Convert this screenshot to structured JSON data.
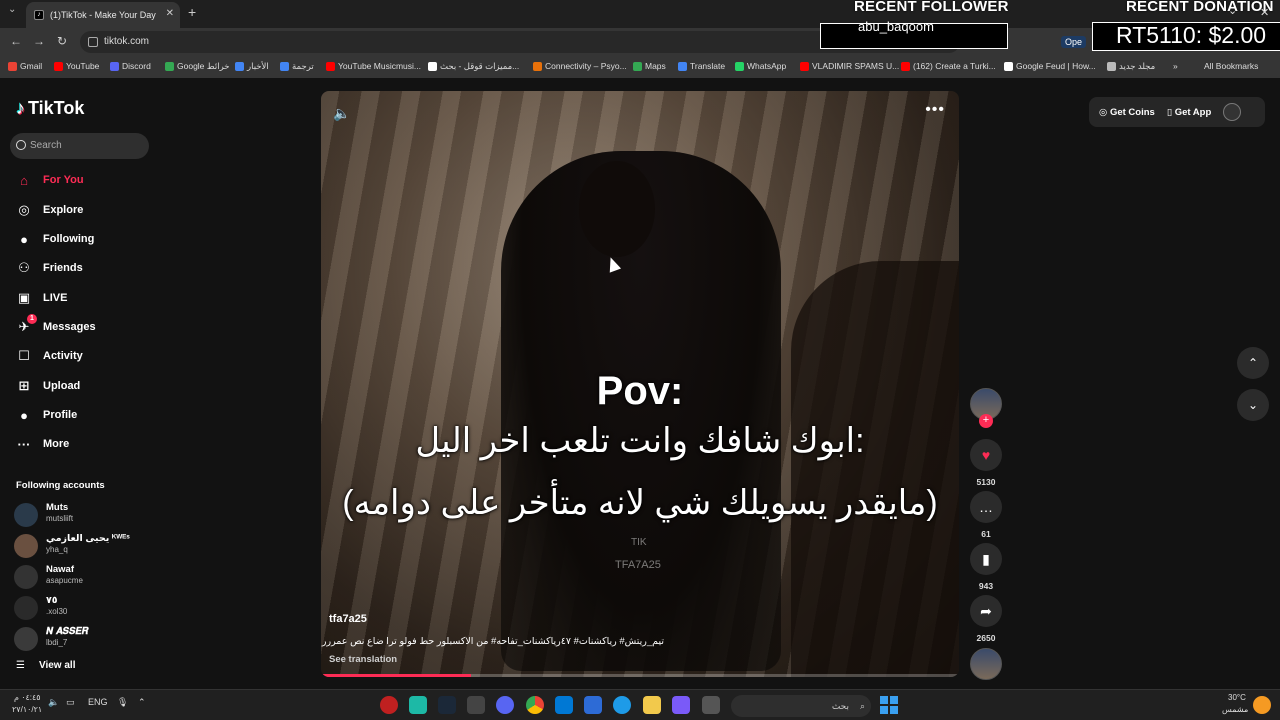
{
  "browser": {
    "tab_title": "(1)TikTok - Make Your Day",
    "tab_favicon": "tiktok-favicon",
    "new_tab": "+",
    "tab_close": "✕",
    "url": "tiktok.com",
    "bookmarks": [
      {
        "label": "Gmail",
        "color": "#ea4335"
      },
      {
        "label": "YouTube",
        "color": "#ff0000"
      },
      {
        "label": "Discord",
        "color": "#5865f2"
      },
      {
        "label": "Google خرائط",
        "color": "#34a853"
      },
      {
        "label": "الأخبار",
        "color": "#4285f4"
      },
      {
        "label": "ترجمة",
        "color": "#4285f4"
      },
      {
        "label": "YouTube Musicmusi...",
        "color": "#ff0000"
      },
      {
        "label": "مميزات قوقل - بحث...",
        "color": "#ffffff"
      },
      {
        "label": "Connectivity – Psyo...",
        "color": "#e8710a"
      },
      {
        "label": "Maps",
        "color": "#34a853"
      },
      {
        "label": "Translate",
        "color": "#4285f4"
      },
      {
        "label": "WhatsApp",
        "color": "#25d366"
      },
      {
        "label": "VLADIMIR SPAMS U...",
        "color": "#ff0000"
      },
      {
        "label": "(162) Create a Turki...",
        "color": "#ff0000"
      },
      {
        "label": "Google Feud | How...",
        "color": "#ffffff"
      },
      {
        "label": "مجلد جديد",
        "color": "#bbbbbb"
      }
    ],
    "bookmarks_more": "»",
    "all_bookmarks": "All Bookmarks"
  },
  "overlay": {
    "recent_follower_title": "RECENT FOLLOWER",
    "recent_follower_name": "abu_baqoom",
    "recent_donation_title": "RECENT DONATION",
    "recent_donation_value": "RT5110: $2.00",
    "open_chip": "Ope"
  },
  "tiktok": {
    "logo": "TikTok",
    "search_placeholder": "Search",
    "nav": [
      {
        "label": "For You",
        "icon": "home-icon",
        "glyph": "⌂",
        "active": true
      },
      {
        "label": "Explore",
        "icon": "compass-icon",
        "glyph": "◎"
      },
      {
        "label": "Following",
        "icon": "following-avatar-icon",
        "glyph": "●"
      },
      {
        "label": "Friends",
        "icon": "friends-icon",
        "glyph": "⚇"
      },
      {
        "label": "LIVE",
        "icon": "live-icon",
        "glyph": "▣"
      },
      {
        "label": "Messages",
        "icon": "messages-icon",
        "glyph": "✈",
        "badge": "1"
      },
      {
        "label": "Activity",
        "icon": "activity-icon",
        "glyph": "☐"
      },
      {
        "label": "Upload",
        "icon": "upload-icon",
        "glyph": "⊞"
      },
      {
        "label": "Profile",
        "icon": "profile-icon",
        "glyph": "●"
      },
      {
        "label": "More",
        "icon": "more-icon",
        "glyph": "···"
      }
    ],
    "following_title": "Following accounts",
    "following_accounts": [
      {
        "name": "Muts",
        "handle": "mutsliift"
      },
      {
        "name": "يحيى العازمي ᴷᵂᴱˢ",
        "handle": "yha_q"
      },
      {
        "name": "Nawaf",
        "handle": "asapucme"
      },
      {
        "name": "٧٥",
        "handle": ".xol30"
      },
      {
        "name": "𝑵 𝑨𝑺𝑺𝑬𝑹",
        "handle": "lbdi_7"
      }
    ],
    "view_all": "View all",
    "top_right": {
      "get_coins": "Get Coins",
      "get_app": "Get App"
    }
  },
  "video": {
    "caption_pov": "Pov:",
    "caption_line2": "ابوك شافك وانت تلعب اخر اليل:",
    "caption_line3": "(مايقدر يسويلك شي لانه متأخر على دوامه)",
    "watermark1": "TIK",
    "watermark2": "TFA7A25",
    "author": "tfa7a25",
    "description": "تيم_ريتش# رياكشنات# ٤٧رياكشنات_تفاحه# من الاكسبلور حط فولو ترا ضاع نص عمرررك",
    "see_translation": "See translation",
    "progress": 0.235,
    "likes": "5130",
    "comments": "61",
    "saves": "943",
    "shares": "2650"
  },
  "taskbar": {
    "time": "٠٤:٤٥ م",
    "date": "٢٧/١٠/٢١",
    "lang": "ENG",
    "search_placeholder": "بحث",
    "weather_temp": "30°C",
    "weather_desc": "مشمس"
  }
}
